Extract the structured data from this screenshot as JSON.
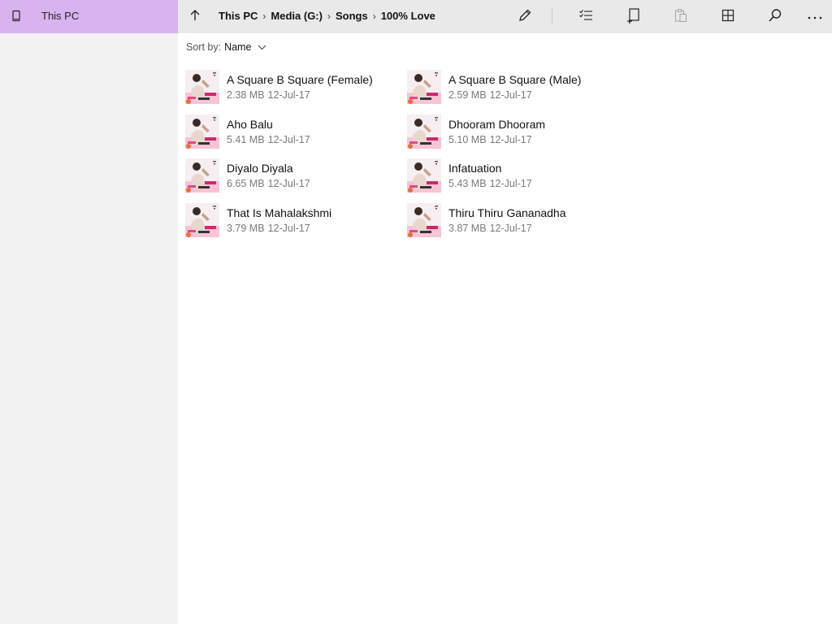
{
  "sidebar": {
    "items": [
      {
        "label": "This PC",
        "icon": "device-icon"
      }
    ]
  },
  "toolbar": {
    "breadcrumb": [
      "This PC",
      "Media (G:)",
      "Songs",
      "100% Love"
    ],
    "separator": "›",
    "icons": [
      "up-arrow-icon",
      "pencil-icon",
      "select-list-icon",
      "new-item-icon",
      "paste-icon",
      "view-grid-icon",
      "search-icon",
      "more-icon"
    ]
  },
  "sort": {
    "label": "Sort by:",
    "value": "Name"
  },
  "files": [
    {
      "name": "A Square B Square (Female)",
      "size": "2.38 MB",
      "date": "12-Jul-17"
    },
    {
      "name": "A Square B Square (Male)",
      "size": "2.59 MB",
      "date": "12-Jul-17"
    },
    {
      "name": "Aho Balu",
      "size": "5.41 MB",
      "date": "12-Jul-17"
    },
    {
      "name": "Dhooram Dhooram",
      "size": "5.10 MB",
      "date": "12-Jul-17"
    },
    {
      "name": "Diyalo Diyala",
      "size": "6.65 MB",
      "date": "12-Jul-17"
    },
    {
      "name": "Infatuation",
      "size": "5.43 MB",
      "date": "12-Jul-17"
    },
    {
      "name": "That Is Mahalakshmi",
      "size": "3.79 MB",
      "date": "12-Jul-17"
    },
    {
      "name": "Thiru Thiru Gananadha",
      "size": "3.87 MB",
      "date": "12-Jul-17"
    }
  ],
  "colors": {
    "sidebar_selected": "#d9b3f0",
    "sidebar_bg": "#f2f2f2",
    "toolbar_bg": "#e9e9e9",
    "meta_text": "#7a7a7a"
  }
}
